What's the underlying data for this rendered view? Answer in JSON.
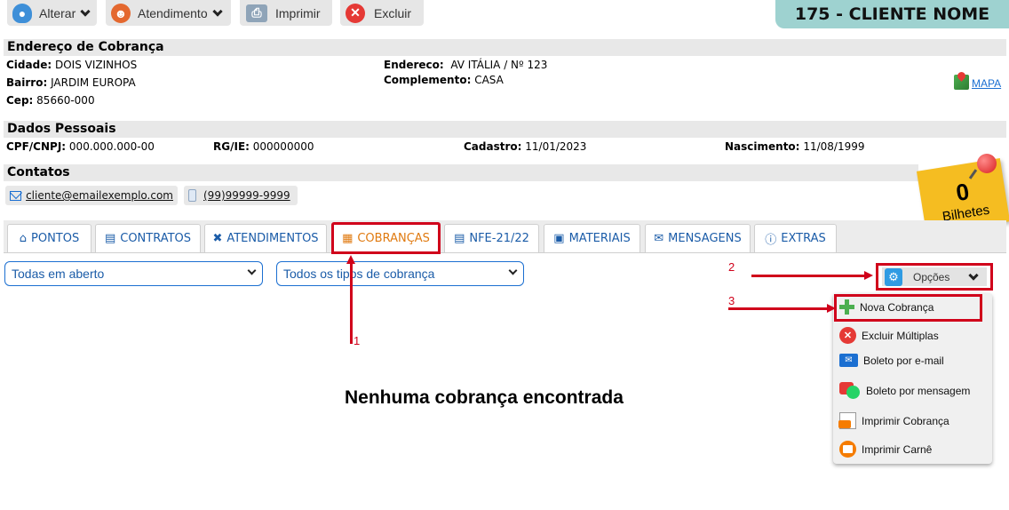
{
  "toolbar": {
    "alterar": "Alterar",
    "atendimento": "Atendimento",
    "imprimir": "Imprimir",
    "excluir": "Excluir"
  },
  "client": {
    "title": "175 - CLIENTE NOME"
  },
  "billing_address": {
    "section_title": "Endereço de Cobrança",
    "cidade_label": "Cidade:",
    "cidade": "DOIS VIZINHOS",
    "bairro_label": "Bairro:",
    "bairro": "JARDIM EUROPA",
    "cep_label": "Cep:",
    "cep": "85660-000",
    "endereco_label": "Endereco:",
    "endereco": "AV ITÁLIA / Nº 123",
    "complemento_label": "Complemento:",
    "complemento": "CASA",
    "map_link": "MAPA"
  },
  "personal": {
    "section_title": "Dados Pessoais",
    "cpf_label": "CPF/CNPJ:",
    "cpf": "000.000.000-00",
    "rg_label": "RG/IE:",
    "rg": "000000000",
    "cadastro_label": "Cadastro:",
    "cadastro": "11/01/2023",
    "nascimento_label": "Nascimento:",
    "nascimento": "11/08/1999"
  },
  "contacts": {
    "section_title": "Contatos",
    "email": "cliente@emailexemplo.com",
    "phone": "(99)99999-9999"
  },
  "tickets": {
    "count": "0",
    "label": "Bilhetes"
  },
  "tabs": [
    {
      "label": "PONTOS",
      "icon": "home-icon"
    },
    {
      "label": "CONTRATOS",
      "icon": "contract-icon"
    },
    {
      "label": "ATENDIMENTOS",
      "icon": "tools-icon"
    },
    {
      "label": "COBRANÇAS",
      "icon": "invoice-icon",
      "active": true
    },
    {
      "label": "NFE-21/22",
      "icon": "document-icon"
    },
    {
      "label": "MATERIAIS",
      "icon": "box-icon"
    },
    {
      "label": "MENSAGENS",
      "icon": "envelope-icon"
    },
    {
      "label": "EXTRAS",
      "icon": "info-icon"
    }
  ],
  "filters": {
    "status": "Todas em aberto",
    "type": "Todos os tipos de cobrança"
  },
  "empty_message": "Nenhuma cobrança encontrada",
  "options": {
    "label": "Opções",
    "items": [
      {
        "label": "Nova Cobrança",
        "icon": "plus-icon",
        "color": "#4caf50"
      },
      {
        "label": "Excluir Múltiplas",
        "icon": "delete-icon",
        "color": "#e53935"
      },
      {
        "label": "Boleto por e-mail",
        "icon": "email-icon",
        "color": "#1b6fd1"
      },
      {
        "label": "Boleto por mensagem",
        "icon": "whatsapp-icon",
        "color": "#25d366"
      },
      {
        "label": "Imprimir Cobrança",
        "icon": "print-invoice-icon",
        "color": "#f57c00"
      },
      {
        "label": "Imprimir Carnê",
        "icon": "print-booklet-icon",
        "color": "#f57c00"
      }
    ]
  },
  "annotations": {
    "n1": "1",
    "n2": "2",
    "n3": "3"
  },
  "colors": {
    "accent_red": "#d0021b",
    "link_blue": "#1b6fd1",
    "tab_active": "#e07a10",
    "header_teal": "#9ed2d0"
  }
}
